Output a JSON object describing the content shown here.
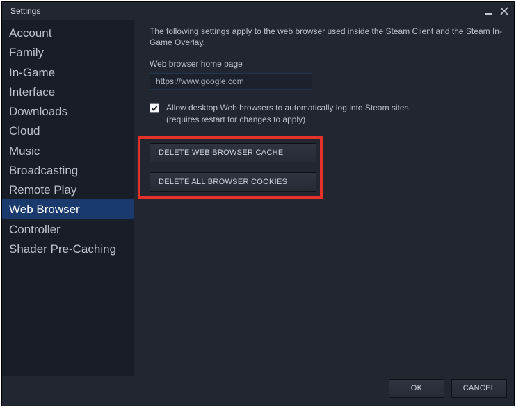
{
  "window": {
    "title": "Settings"
  },
  "sidebar": {
    "items": [
      {
        "label": "Account"
      },
      {
        "label": "Family"
      },
      {
        "label": "In-Game"
      },
      {
        "label": "Interface"
      },
      {
        "label": "Downloads"
      },
      {
        "label": "Cloud"
      },
      {
        "label": "Music"
      },
      {
        "label": "Broadcasting"
      },
      {
        "label": "Remote Play"
      },
      {
        "label": "Web Browser"
      },
      {
        "label": "Controller"
      },
      {
        "label": "Shader Pre-Caching"
      }
    ],
    "selected_index": 9
  },
  "content": {
    "description": "The following settings apply to the web browser used inside the Steam Client and the Steam In-Game Overlay.",
    "homepage_label": "Web browser home page",
    "homepage_value": "https://www.google.com",
    "auto_login_label": "Allow desktop Web browsers to automatically log into Steam sites\n(requires restart for changes to apply)",
    "auto_login_checked": true,
    "delete_cache_button": "DELETE WEB BROWSER CACHE",
    "delete_cookies_button": "DELETE ALL BROWSER COOKIES"
  },
  "footer": {
    "ok": "OK",
    "cancel": "CANCEL"
  }
}
